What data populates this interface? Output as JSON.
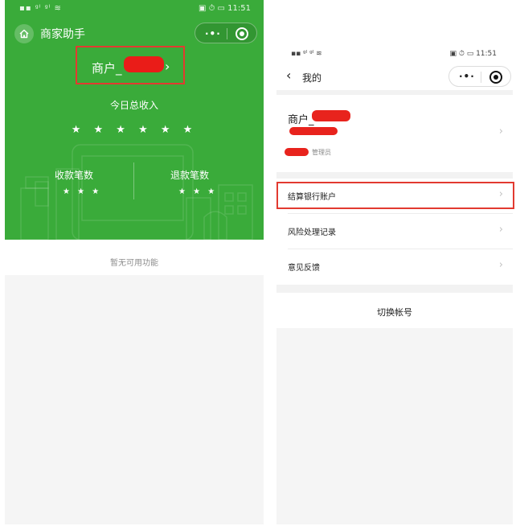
{
  "left_screen": {
    "status_bar": {
      "signal": "▪▪ ᵍˡ ᵍˡ ≋",
      "right": "▣ ⏱ ▭ 11:51"
    },
    "app_title": "商家助手",
    "capsule": {
      "dots": "·•·"
    },
    "merchant": {
      "name": "商户_",
      "chevron": "›"
    },
    "income": {
      "label": "今日总收入",
      "value": "★ ★ ★ ★ ★ ★"
    },
    "collect_count": {
      "label": "收款笔数",
      "value": "★ ★ ★"
    },
    "refund_count": {
      "label": "退款笔数",
      "value": "★ ★ ★"
    },
    "no_function_text": "暂无可用功能",
    "colors": {
      "brand_green": "#3aab3a",
      "highlight_red": "#e23a30",
      "redaction_red": "#ea1c18"
    }
  },
  "right_screen": {
    "status_bar": {
      "signal": "▪▪ ᵍˡ ᵍˡ ≋",
      "right": "▣ ⏱ ▭ 11:51"
    },
    "nav": {
      "back": "‹",
      "title": "我的"
    },
    "capsule": {
      "dots": "·•·"
    },
    "profile": {
      "name": "商户_",
      "role": "管理员"
    },
    "menu": [
      {
        "label": "结算银行账户",
        "chevron": "›"
      },
      {
        "label": "风险处理记录",
        "chevron": "›"
      },
      {
        "label": "意见反馈",
        "chevron": "›"
      }
    ],
    "switch_account": "切换帐号"
  }
}
